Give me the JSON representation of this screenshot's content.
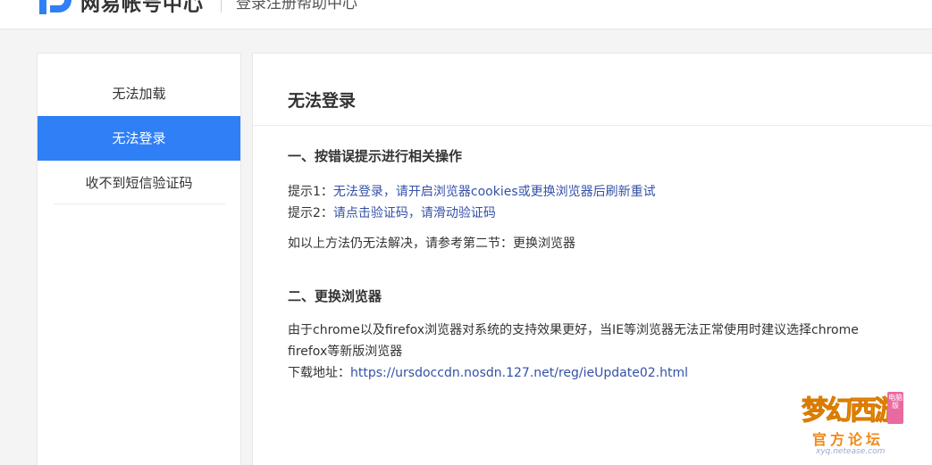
{
  "header": {
    "brand": "网易帐号中心",
    "subtitle": "登录注册帮助中心"
  },
  "sidebar": {
    "items": [
      {
        "label": "无法加载",
        "active": false
      },
      {
        "label": "无法登录",
        "active": true
      },
      {
        "label": "收不到短信验证码",
        "active": false
      }
    ]
  },
  "main": {
    "title": "无法登录",
    "section1": {
      "heading": "一、按错误提示进行相关操作",
      "hint1_label": "提示1：",
      "hint1_text": "无法登录，请开启浏览器cookies或更换浏览器后刷新重试",
      "hint2_label": "提示2：",
      "hint2_text": "请点击验证码，请滑动验证码",
      "fallback": "如以上方法仍无法解决，请参考第二节：更换浏览器"
    },
    "section2": {
      "heading": "二、更换浏览器",
      "para_line1": "由于chrome以及firefox浏览器对系统的支持效果更好，当IE等浏览器无法正常使用时建议选择chrome",
      "para_line2": "firefox等新版浏览器",
      "download_label": "下载地址：",
      "download_url": "https://ursdoccdn.nosdn.127.net/reg/ieUpdate02.html"
    }
  },
  "watermark": {
    "main": "梦幻西游",
    "badge": "电脑版",
    "sub": "官方论坛",
    "url": "xyq.netease.com"
  },
  "colors": {
    "accent": "#2f7ff6",
    "link": "#3451a8"
  }
}
